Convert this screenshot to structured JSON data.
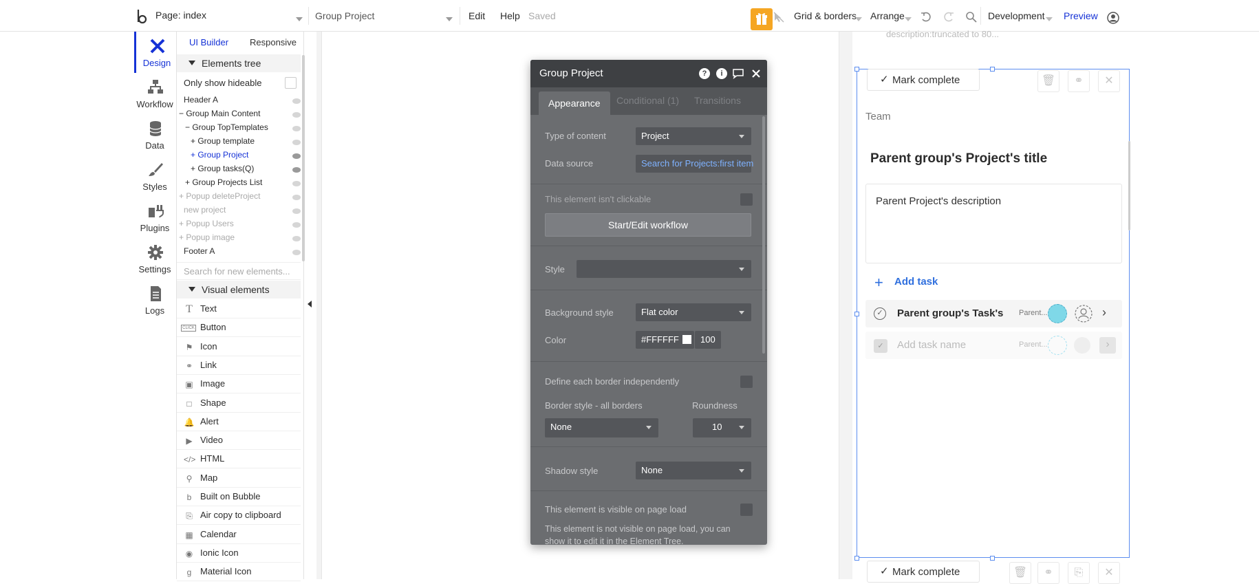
{
  "topbar": {
    "page_label": "Page: index",
    "element_label": "Group Project",
    "menu_edit": "Edit",
    "menu_help": "Help",
    "status": "Saved",
    "grid": "Grid & borders",
    "arrange": "Arrange",
    "env": "Development",
    "preview": "Preview"
  },
  "nav": [
    {
      "label": "Design",
      "icon": "design-icon"
    },
    {
      "label": "Workflow",
      "icon": "workflow-icon"
    },
    {
      "label": "Data",
      "icon": "database-icon"
    },
    {
      "label": "Styles",
      "icon": "brush-icon"
    },
    {
      "label": "Plugins",
      "icon": "plug-icon"
    },
    {
      "label": "Settings",
      "icon": "gear-icon"
    },
    {
      "label": "Logs",
      "icon": "document-icon"
    }
  ],
  "panel": {
    "tab_ui": "UI Builder",
    "tab_responsive": "Responsive",
    "elements_tree": "Elements tree",
    "only_hideable": "Only show hideable",
    "tree": [
      {
        "label": "Header A"
      },
      {
        "label": "Group Main Content"
      },
      {
        "label": "Group TopTemplates"
      },
      {
        "label": "Group template"
      },
      {
        "label": "Group Project"
      },
      {
        "label": "Group tasks(Q)"
      },
      {
        "label": "Group Projects List"
      },
      {
        "label": "Popup deleteProject"
      },
      {
        "label": "new project"
      },
      {
        "label": "Popup Users"
      },
      {
        "label": "Popup image"
      },
      {
        "label": "Footer A"
      }
    ],
    "search_placeholder": "Search for new elements...",
    "visual_elements": "Visual elements",
    "visual": [
      {
        "label": "Text",
        "icon": "T"
      },
      {
        "label": "Button",
        "icon": "CLICK"
      },
      {
        "label": "Icon",
        "icon": "⚑"
      },
      {
        "label": "Link",
        "icon": "⚭"
      },
      {
        "label": "Image",
        "icon": "▣"
      },
      {
        "label": "Shape",
        "icon": "□"
      },
      {
        "label": "Alert",
        "icon": "🔔"
      },
      {
        "label": "Video",
        "icon": "▶"
      },
      {
        "label": "HTML",
        "icon": "</>"
      },
      {
        "label": "Map",
        "icon": "⚲"
      },
      {
        "label": "Built on Bubble",
        "icon": "b"
      },
      {
        "label": "Air copy to clipboard",
        "icon": "⎘"
      },
      {
        "label": "Calendar",
        "icon": "▦"
      },
      {
        "label": "Ionic Icon",
        "icon": "◉"
      },
      {
        "label": "Material Icon",
        "icon": "g"
      }
    ]
  },
  "editor": {
    "title": "Group Project",
    "tab_appearance": "Appearance",
    "tab_conditional": "Conditional (1)",
    "tab_transitions": "Transitions",
    "type_label": "Type of content",
    "type_value": "Project",
    "source_label": "Data source",
    "source_value": "Search for Projects:first item",
    "not_clickable": "This element isn't clickable",
    "workflow_btn": "Start/Edit workflow",
    "style_label": "Style",
    "bg_label": "Background style",
    "bg_value": "Flat color",
    "color_label": "Color",
    "color_hex": "#FFFFFF",
    "color_opacity": "100",
    "border_indep": "Define each border independently",
    "border_style_label": "Border style - all borders",
    "border_style_value": "None",
    "roundness_label": "Roundness",
    "roundness_value": "10",
    "shadow_label": "Shadow style",
    "shadow_value": "None",
    "visible_label": "This element is visible on page load",
    "visible_note": "This element is not visible on page load, you can show it to edit it in the Element Tree."
  },
  "preview": {
    "truncated_text": "description:truncated to 80...",
    "mark_complete": "Mark complete",
    "team": "Team",
    "project_title": "Parent group's Project's title",
    "project_desc": "Parent Project's description",
    "add_task": "Add task",
    "task_name": "Parent group's Task's",
    "task_meta": "Parent...",
    "add_task_placeholder": "Add task name",
    "task_meta2": "Parent..."
  },
  "colors": {
    "accent": "#1532d6",
    "link": "#2f6fde",
    "gift": "#f5a623",
    "selection": "#5b8def"
  }
}
